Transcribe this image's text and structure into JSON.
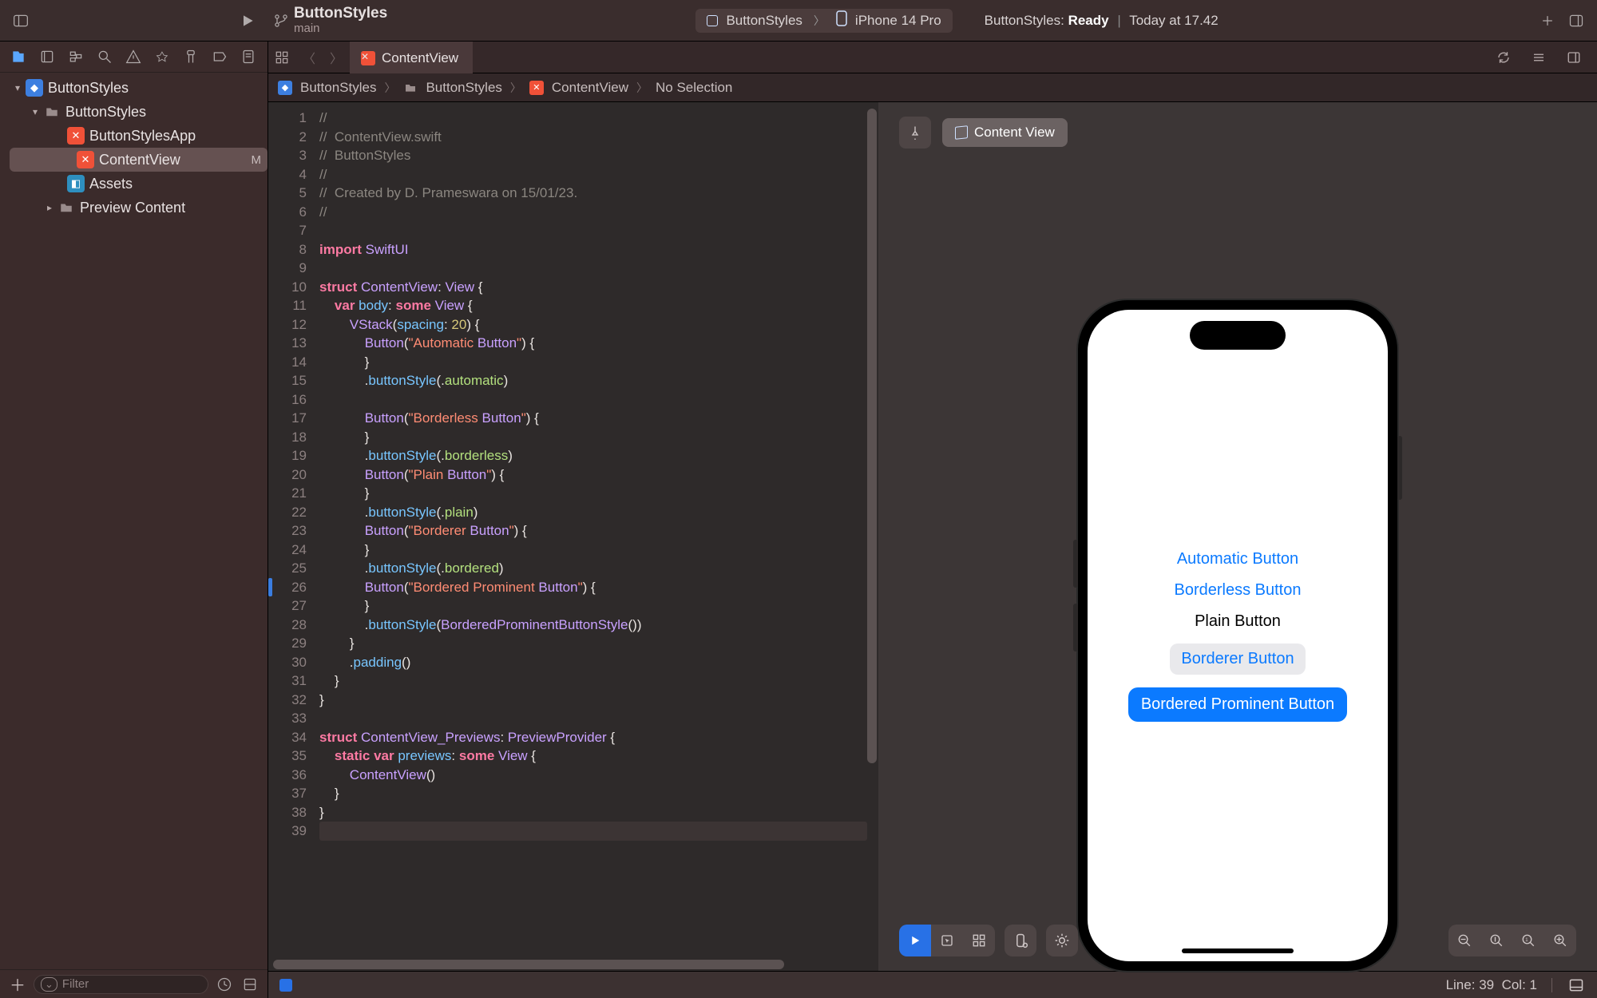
{
  "toolbar": {
    "project_name": "ButtonStyles",
    "branch": "main",
    "scheme": "ButtonStyles",
    "device": "iPhone 14 Pro",
    "status_prefix": "ButtonStyles:",
    "status_state": "Ready",
    "status_time": "Today at 17.42"
  },
  "navigator": {
    "root": "ButtonStyles",
    "group": "ButtonStyles",
    "items": [
      {
        "label": "ButtonStylesApp",
        "kind": "swift"
      },
      {
        "label": "ContentView",
        "kind": "swift",
        "selected": true,
        "badge": "M"
      },
      {
        "label": "Assets",
        "kind": "assets"
      },
      {
        "label": "Preview Content",
        "kind": "folder",
        "hasChildren": true
      }
    ],
    "filter_placeholder": "Filter"
  },
  "tabs": {
    "open_file": "ContentView"
  },
  "jump_bar": {
    "segments": [
      "ButtonStyles",
      "ButtonStyles",
      "ContentView",
      "No Selection"
    ]
  },
  "editor": {
    "line_count": 39,
    "current_line": 39,
    "change_marker_line": 26,
    "lines": [
      "//",
      "//  ContentView.swift",
      "//  ButtonStyles",
      "//",
      "//  Created by D. Prameswara on 15/01/23.",
      "//",
      "",
      "import SwiftUI",
      "",
      "struct ContentView: View {",
      "    var body: some View {",
      "        VStack(spacing: 20) {",
      "            Button(\"Automatic Button\") {",
      "            }",
      "            .buttonStyle(.automatic)",
      "",
      "            Button(\"Borderless Button\") {",
      "            }",
      "            .buttonStyle(.borderless)",
      "            Button(\"Plain Button\") {",
      "            }",
      "            .buttonStyle(.plain)",
      "            Button(\"Borderer Button\") {",
      "            }",
      "            .buttonStyle(.bordered)",
      "            Button(\"Bordered Prominent Button\") {",
      "            }",
      "            .buttonStyle(BorderedProminentButtonStyle())",
      "        }",
      "        .padding()",
      "    }",
      "}",
      "",
      "struct ContentView_Previews: PreviewProvider {",
      "    static var previews: some View {",
      "        ContentView()",
      "    }",
      "}",
      ""
    ]
  },
  "preview": {
    "header_label": "Content View",
    "buttons": {
      "automatic": "Automatic Button",
      "borderless": "Borderless Button",
      "plain": "Plain Button",
      "bordered": "Borderer Button",
      "prominent": "Bordered Prominent Button"
    }
  },
  "status": {
    "line_label": "Line:",
    "line_val": "39",
    "col_label": "Col:",
    "col_val": "1"
  }
}
